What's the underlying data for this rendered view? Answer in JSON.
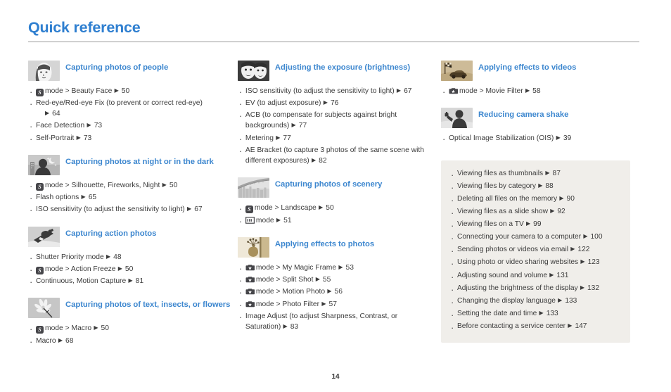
{
  "page": {
    "title": "Quick reference",
    "number": "14",
    "accent_color": "#3d87cf",
    "title_color": "#2f7fd0",
    "callout_bg": "#f0eeea"
  },
  "columns": [
    {
      "sections": [
        {
          "icon": "portrait-face-thumbnail",
          "title": "Capturing photos of people",
          "items": [
            {
              "icon": "smart-mode-icon",
              "text": "mode > Beauty Face",
              "arrow": "▶",
              "page": "50"
            },
            {
              "icon": null,
              "text": "Red-eye/Red-eye Fix (to prevent or correct red-eye)",
              "wrap": true,
              "arrow": "▶",
              "page": "64"
            },
            {
              "icon": null,
              "text": "Face Detection",
              "arrow": "▶",
              "page": "73"
            },
            {
              "icon": null,
              "text": "Self-Portrait",
              "arrow": "▶",
              "page": "73"
            }
          ]
        },
        {
          "icon": "night-scene-thumbnail",
          "title": "Capturing photos at night or in the dark",
          "items": [
            {
              "icon": "smart-mode-icon",
              "text": "mode > Silhouette, Fireworks, Night",
              "arrow": "▶",
              "page": "50"
            },
            {
              "icon": null,
              "text": "Flash options",
              "arrow": "▶",
              "page": "65"
            },
            {
              "icon": null,
              "text": "ISO sensitivity (to adjust the sensitivity to light)",
              "arrow": "▶",
              "page": "67"
            }
          ]
        },
        {
          "icon": "snowboarder-action-thumbnail",
          "title": "Capturing action photos",
          "items": [
            {
              "icon": null,
              "text": "Shutter Priority mode",
              "arrow": "▶",
              "page": "48"
            },
            {
              "icon": "smart-mode-icon",
              "text": "mode > Action Freeze",
              "arrow": "▶",
              "page": "50"
            },
            {
              "icon": null,
              "text": "Continuous, Motion Capture",
              "arrow": "▶",
              "page": "81"
            }
          ]
        },
        {
          "icon": "flower-macro-thumbnail",
          "title": "Capturing photos of text, insects, or flowers",
          "items": [
            {
              "icon": "smart-mode-icon",
              "text": "mode > Macro",
              "arrow": "▶",
              "page": "50"
            },
            {
              "icon": null,
              "text": "Macro",
              "arrow": "▶",
              "page": "68"
            }
          ]
        }
      ]
    },
    {
      "sections": [
        {
          "icon": "two-faces-exposure-thumbnail",
          "title": "Adjusting the exposure (brightness)",
          "items": [
            {
              "icon": null,
              "text": "ISO sensitivity (to adjust the sensitivity to light)",
              "arrow": "▶",
              "page": "67"
            },
            {
              "icon": null,
              "text": "EV (to adjust exposure)",
              "arrow": "▶",
              "page": "76"
            },
            {
              "icon": null,
              "text": "ACB (to compensate for subjects against bright backgrounds)",
              "arrow": "▶",
              "page": "77"
            },
            {
              "icon": null,
              "text": "Metering",
              "arrow": "▶",
              "page": "77"
            },
            {
              "icon": null,
              "text": "AE Bracket (to capture 3 photos of the same scene with different exposures)",
              "arrow": "▶",
              "page": "82"
            }
          ]
        },
        {
          "icon": "bridge-scenery-thumbnail",
          "title": "Capturing photos of scenery",
          "items": [
            {
              "icon": "smart-mode-icon",
              "text": "mode > Landscape",
              "arrow": "▶",
              "page": "50"
            },
            {
              "icon": "panorama-mode-icon",
              "text": "mode",
              "arrow": "▶",
              "page": "51"
            }
          ]
        },
        {
          "icon": "vase-effects-thumbnail",
          "title": "Applying effects to photos",
          "items": [
            {
              "icon": "magic-mode-icon",
              "text": "mode > My Magic Frame",
              "arrow": "▶",
              "page": "53"
            },
            {
              "icon": "magic-mode-icon",
              "text": "mode > Split Shot",
              "arrow": "▶",
              "page": "55"
            },
            {
              "icon": "magic-mode-icon",
              "text": "mode > Motion Photo",
              "arrow": "▶",
              "page": "56"
            },
            {
              "icon": "magic-mode-icon",
              "text": "mode > Photo Filter",
              "arrow": "▶",
              "page": "57"
            },
            {
              "icon": null,
              "text": "Image Adjust (to adjust Sharpness, Contrast, or Saturation)",
              "arrow": "▶",
              "page": "83"
            }
          ]
        }
      ]
    },
    {
      "sections": [
        {
          "icon": "race-car-video-thumbnail",
          "title": "Applying effects to videos",
          "items": [
            {
              "icon": "magic-mode-icon",
              "text": "mode > Movie Filter",
              "arrow": "▶",
              "page": "58"
            }
          ]
        },
        {
          "icon": "camera-shake-thumbnail",
          "title": "Reducing camera shake",
          "items": [
            {
              "icon": null,
              "text": "Optical Image Stabilization (OIS)",
              "arrow": "▶",
              "page": "39"
            }
          ]
        }
      ],
      "callout": {
        "items": [
          {
            "text": "Viewing files as thumbnails",
            "arrow": "▶",
            "page": "87"
          },
          {
            "text": "Viewing files by category",
            "arrow": "▶",
            "page": "88"
          },
          {
            "text": "Deleting all files on the memory",
            "arrow": "▶",
            "page": "90"
          },
          {
            "text": "Viewing files as a slide show",
            "arrow": "▶",
            "page": "92"
          },
          {
            "text": "Viewing files on a TV",
            "arrow": "▶",
            "page": "99"
          },
          {
            "text": "Connecting your camera to a computer",
            "arrow": "▶",
            "page": "100"
          },
          {
            "text": "Sending photos or videos via email",
            "arrow": "▶",
            "page": "122"
          },
          {
            "text": "Using photo or video sharing websites",
            "arrow": "▶",
            "page": "123"
          },
          {
            "text": "Adjusting sound and volume",
            "arrow": "▶",
            "page": "131"
          },
          {
            "text": "Adjusting the brightness of the display",
            "arrow": "▶",
            "page": "132"
          },
          {
            "text": "Changing the display language",
            "arrow": "▶",
            "page": "133"
          },
          {
            "text": "Setting the date and time",
            "arrow": "▶",
            "page": "133"
          },
          {
            "text": "Before contacting a service center",
            "arrow": "▶",
            "page": "147"
          }
        ]
      }
    }
  ]
}
